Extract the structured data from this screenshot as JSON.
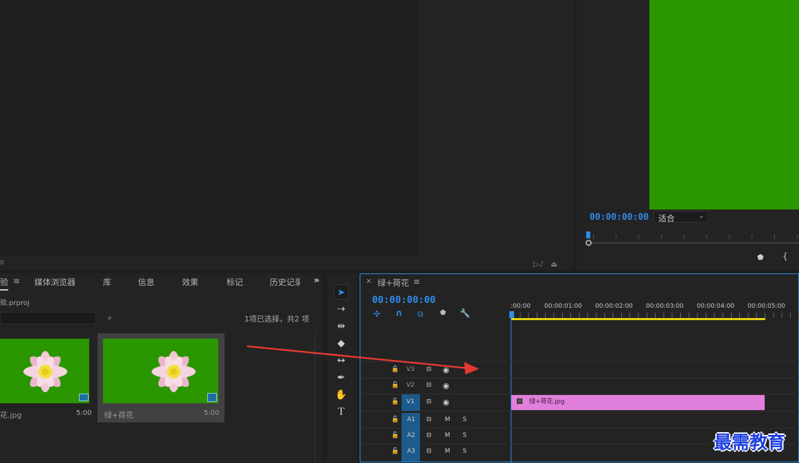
{
  "program": {
    "timecode": "00:00:00:00",
    "zoom_value": "适合"
  },
  "project": {
    "tabs": [
      "验",
      "媒体浏览器",
      "库",
      "信息",
      "效果",
      "标记",
      "历史记录"
    ],
    "file_name": "验.prproj",
    "status": "1项已选择，共2 项",
    "items": [
      {
        "name": "花.jpg",
        "duration": "5:00"
      },
      {
        "name": "绿+荷花",
        "duration": "5:00"
      }
    ]
  },
  "timeline": {
    "sequence_name": "绿+荷花",
    "timecode": "00:00:00:00",
    "ruler_labels": [
      ":00:00",
      "00:00:01:00",
      "00:00:02:00",
      "00:00:03:00",
      "00:00:04:00",
      "00:00:05:00"
    ],
    "video_tracks": [
      "V3",
      "V2",
      "V1"
    ],
    "audio_tracks": [
      "A1",
      "A2",
      "A3"
    ],
    "clip_name": "绿+荷花.jpg",
    "mute_label": "M",
    "solo_label": "S"
  },
  "watermark": "最需教育",
  "colors": {
    "accent": "#2d8ceb",
    "clip": "#e07fdc",
    "green": "#2a9600",
    "work_area": "#e8d20f",
    "arrow": "#e23a32"
  }
}
